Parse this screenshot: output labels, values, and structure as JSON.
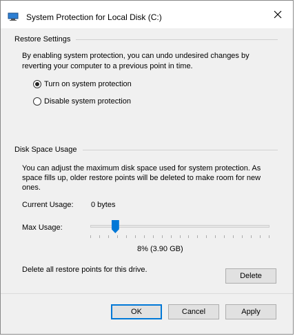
{
  "window": {
    "title": "System Protection for Local Disk (C:)"
  },
  "restore_settings": {
    "heading": "Restore Settings",
    "description_line1": "By enabling system protection, you can undo undesired changes by",
    "description_line2": "reverting your computer to a previous point in time.",
    "options": [
      {
        "label": "Turn on system protection",
        "checked": true
      },
      {
        "label": "Disable system protection",
        "checked": false
      }
    ]
  },
  "disk_space": {
    "heading": "Disk Space Usage",
    "description_line1": "You can adjust the maximum disk space used for system protection. As",
    "description_line2": "space fills up, older restore points will be deleted to make room for new",
    "description_line3": "ones.",
    "current_usage_label": "Current Usage:",
    "current_usage_value": "0 bytes",
    "max_usage_label": "Max Usage:",
    "max_usage_fraction": 0.08,
    "max_usage_value": "8% (3.90 GB)",
    "delete_text": "Delete all restore points for this drive.",
    "delete_button": "Delete"
  },
  "buttons": {
    "ok": "OK",
    "cancel": "Cancel",
    "apply": "Apply"
  }
}
